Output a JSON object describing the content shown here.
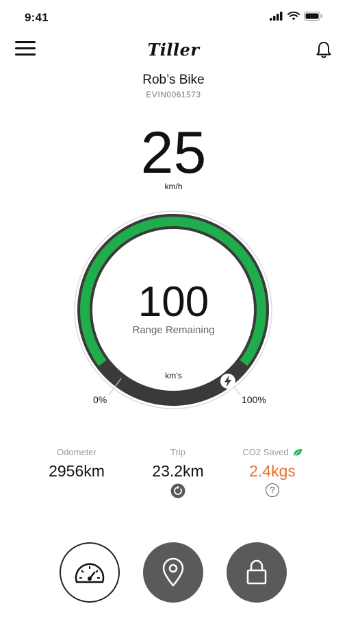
{
  "status_bar": {
    "time": "9:41"
  },
  "header": {
    "logo_text": "Tiller",
    "menu_icon": "hamburger-menu-icon",
    "bell_icon": "bell-icon"
  },
  "bike": {
    "name": "Rob’s Bike",
    "id": "EVIN0061573"
  },
  "speed": {
    "value": "25",
    "unit": "km/h"
  },
  "range": {
    "value": "100",
    "label": "Range Remaining",
    "unit": "km’s",
    "battery_level_percent": 100
  },
  "scale": {
    "min_label": "0%",
    "max_label": "100%"
  },
  "stats": {
    "odometer": {
      "label": "Odometer",
      "value": "2956km"
    },
    "trip": {
      "label": "Trip",
      "value": "23.2km"
    },
    "co2": {
      "label": "CO2 Saved",
      "value": "2.4kgs",
      "info": "?"
    }
  },
  "colors": {
    "accent_green": "#1fae4b",
    "co2_orange": "#e8722a",
    "dark_gray": "#5a5a5a"
  }
}
